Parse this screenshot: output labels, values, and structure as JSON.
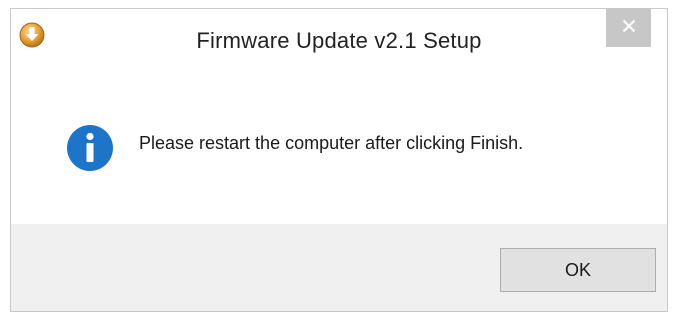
{
  "window": {
    "title": "Firmware Update v2.1 Setup",
    "app_icon": "setup-download-icon",
    "close_icon": "close-icon"
  },
  "content": {
    "icon": "info-icon",
    "message": "Please restart the computer after clicking Finish."
  },
  "footer": {
    "ok_label": "OK"
  },
  "colors": {
    "info_blue": "#1e74c8",
    "app_icon_orange": "#e8a13a",
    "close_button_bg": "#c7c7c7",
    "content_bg": "#ffffff",
    "footer_bg": "#f0f0f0"
  }
}
